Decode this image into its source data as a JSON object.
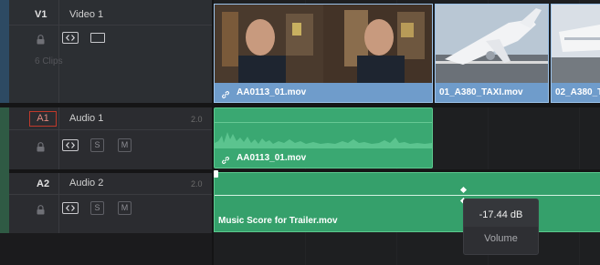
{
  "tracks": {
    "v1": {
      "id": "V1",
      "name": "Video 1",
      "clip_count": "6 Clips"
    },
    "a1": {
      "id": "A1",
      "name": "Audio 1",
      "level": "2.0",
      "solo": "S",
      "mute": "M"
    },
    "a2": {
      "id": "A2",
      "name": "Audio 2",
      "level": "2.0",
      "solo": "S",
      "mute": "M"
    }
  },
  "clips": {
    "video": [
      {
        "name": "AA0113_01.mov"
      },
      {
        "name": "01_A380_TAXI.mov"
      },
      {
        "name": "02_A380_T"
      }
    ],
    "audio1": {
      "name": "AA0113_01.mov"
    },
    "audio2": {
      "name": "Music Score for Trailer.mov"
    }
  },
  "tooltip": {
    "value": "-17.44 dB",
    "label": "Volume"
  },
  "colors": {
    "video_clip": "#6f9ccb",
    "audio_clip": "#3aa872",
    "waveform": "#5cc98e",
    "track_header": "#2a2b2e",
    "a1_badge_border": "#c0392b"
  }
}
